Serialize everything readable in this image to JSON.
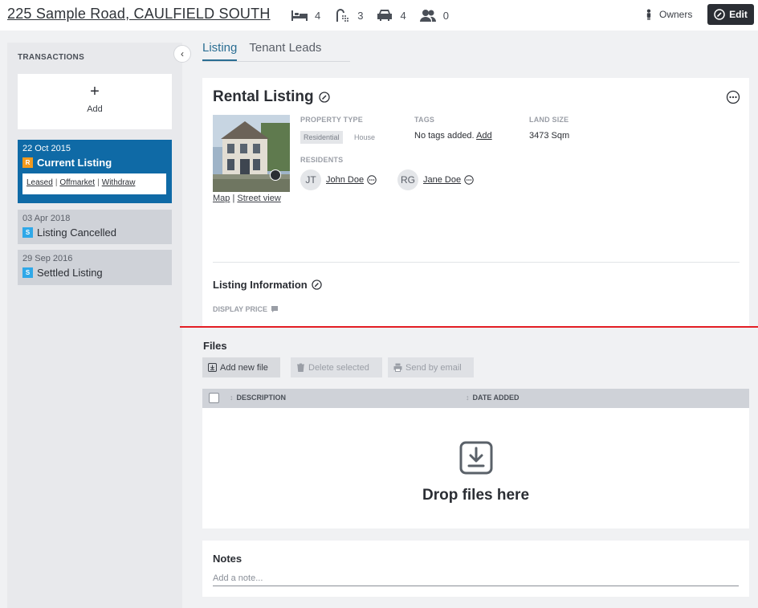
{
  "header": {
    "address": "225 Sample Road, CAULFIELD SOUTH",
    "stats": [
      {
        "icon": "bed-icon",
        "value": "4"
      },
      {
        "icon": "shower-icon",
        "value": "3"
      },
      {
        "icon": "car-icon",
        "value": "4"
      },
      {
        "icon": "people-icon",
        "value": "0"
      }
    ],
    "owners_label": "Owners",
    "edit_label": "Edit"
  },
  "sidebar": {
    "title": "TRANSACTIONS",
    "add_label": "Add",
    "transactions": [
      {
        "date": "22 Oct 2015",
        "badge": "R",
        "title": "Current Listing",
        "actions": [
          "Leased",
          "Offmarket",
          "Withdraw"
        ]
      },
      {
        "date": "03 Apr 2018",
        "badge": "S",
        "title": "Listing Cancelled"
      },
      {
        "date": "29 Sep 2016",
        "badge": "S",
        "title": "Settled Listing"
      }
    ]
  },
  "tabs": [
    "Listing",
    "Tenant Leads"
  ],
  "listing": {
    "title": "Rental Listing",
    "map_link": "Map",
    "street_view_link": "Street view",
    "property_type_label": "PROPERTY TYPE",
    "property_type": "Residential",
    "property_subtype": "House",
    "tags_label": "TAGS",
    "tags_value": "No tags added.",
    "tags_add": "Add",
    "land_size_label": "LAND SIZE",
    "land_size": "3473 Sqm",
    "residents_label": "RESIDENTS",
    "residents": [
      {
        "initials": "JT",
        "name": "John Doe"
      },
      {
        "initials": "RG",
        "name": "Jane Doe"
      }
    ],
    "info_title": "Listing Information",
    "display_price_label": "DISPLAY PRICE"
  },
  "files": {
    "title": "Files",
    "add_label": "Add new file",
    "delete_label": "Delete selected",
    "email_label": "Send by email",
    "columns": [
      "DESCRIPTION",
      "DATE ADDED"
    ],
    "drop_text": "Drop files here"
  },
  "notes": {
    "title": "Notes",
    "placeholder": "Add a note..."
  }
}
